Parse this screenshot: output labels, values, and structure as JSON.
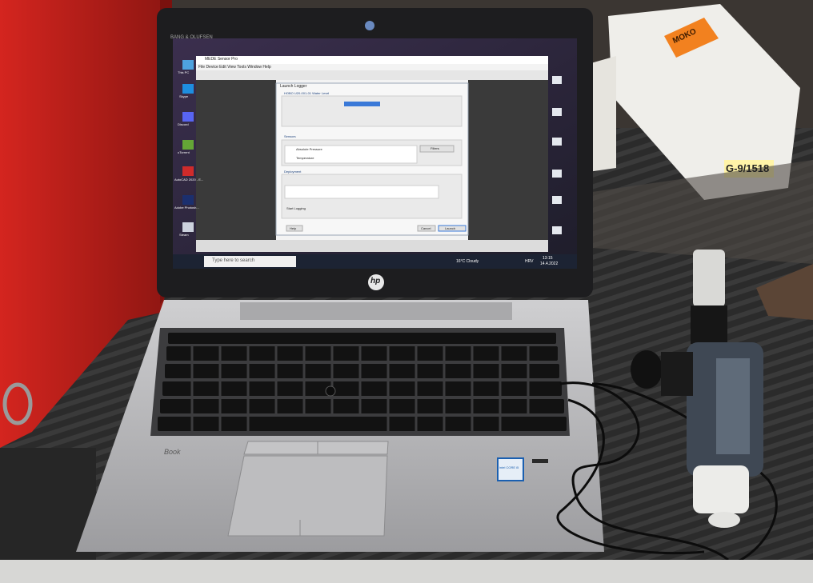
{
  "scene": {
    "laptop_bezel_brand": "BANG & OLUFSEN",
    "laptop_logo": "hp",
    "laptop_model_fragment": "Book",
    "intel_sticker": "intel CORE i5",
    "box_label": "G-9/1518",
    "box_sticker": "MOKO",
    "screen": {
      "window_title": "MEDE Sensor Pro",
      "menu": "File  Device  Edit  View  Tools  Window  Help",
      "dialog_title": "Launch Logger",
      "section_device": "HOBO U20-001-01 Water Level",
      "section_sensors": "Sensors",
      "section_deployment": "Deployment",
      "sensor_1": "Absolute Pressure",
      "sensor_2": "Temperature",
      "filters_button": "Filters",
      "start_logging": "Start Logging",
      "launch_button": "Launch",
      "cancel_button": "Cancel",
      "help_button": "Help",
      "taskbar_search": "Type here to search",
      "taskbar_weather": "16°C Cloudy",
      "taskbar_clock": "13:15",
      "taskbar_date": "14.4.2022",
      "taskbar_lang": "HRV",
      "desktop_icons": [
        "This PC",
        "Skype",
        "Discord",
        "uTorrent",
        "AutoCAD 2020 - E...",
        "Adobe Photosh...",
        "Steam"
      ]
    }
  },
  "colors": {
    "red_case": "#b3201b",
    "mat": "#2a2a2a",
    "laptop_silver": "#b9b9bb",
    "screen_bg": "#2a2434"
  }
}
